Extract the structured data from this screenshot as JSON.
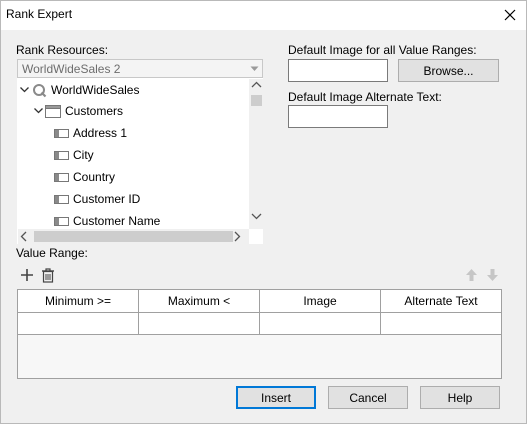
{
  "window": {
    "title": "Rank Expert"
  },
  "rank_resources": {
    "label": "Rank Resources:",
    "selected": "WorldWideSales 2",
    "tree": [
      {
        "label": "WorldWideSales",
        "icon": "query-icon",
        "expanded": true
      },
      {
        "label": "Customers",
        "icon": "table-icon",
        "expanded": true
      },
      {
        "label": "Address 1",
        "icon": "field-icon"
      },
      {
        "label": "City",
        "icon": "field-icon"
      },
      {
        "label": "Country",
        "icon": "field-icon"
      },
      {
        "label": "Customer ID",
        "icon": "field-icon"
      },
      {
        "label": "Customer Name",
        "icon": "field-icon"
      }
    ]
  },
  "default_image": {
    "label": "Default Image for all Value Ranges:",
    "value": "",
    "browse_label": "Browse..."
  },
  "default_alt_text": {
    "label": "Default Image Alternate Text:",
    "value": ""
  },
  "value_range": {
    "label": "Value Range:",
    "columns": [
      "Minimum >=",
      "Maximum <",
      "Image",
      "Alternate Text"
    ],
    "rows": [
      [
        "",
        "",
        "",
        ""
      ]
    ]
  },
  "buttons": {
    "insert": "Insert",
    "cancel": "Cancel",
    "help": "Help"
  }
}
